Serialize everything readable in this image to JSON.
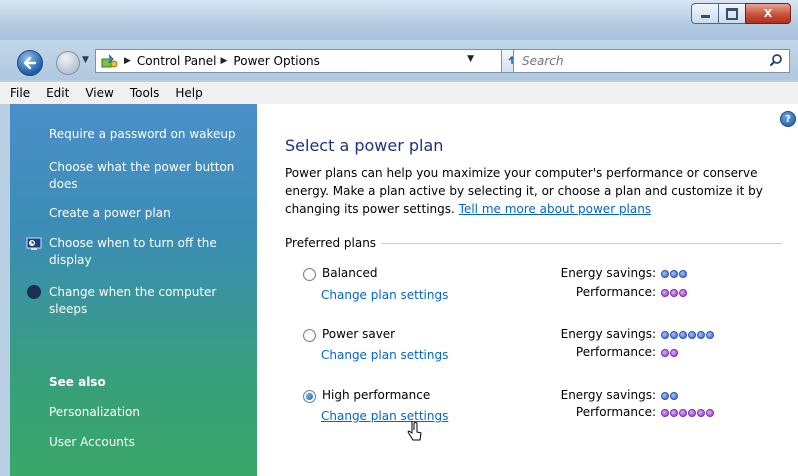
{
  "window": {
    "minimize": "",
    "maximize": "",
    "close": "X"
  },
  "nav": {
    "breadcrumbs": [
      "Control Panel",
      "Power Options"
    ],
    "search_placeholder": "Search"
  },
  "menu": [
    "File",
    "Edit",
    "View",
    "Tools",
    "Help"
  ],
  "sidebar": {
    "tasks": [
      {
        "label": "Require a password on wakeup",
        "icon": ""
      },
      {
        "label": "Choose what the power button does",
        "icon": ""
      },
      {
        "label": "Create a power plan",
        "icon": ""
      },
      {
        "label": "Choose when to turn off the display",
        "icon": "monitor-clock-icon"
      },
      {
        "label": "Change when the computer sleeps",
        "icon": "moon-icon"
      }
    ],
    "see_also_heading": "See also",
    "see_also": [
      "Personalization",
      "User Accounts"
    ]
  },
  "main": {
    "title": "Select a power plan",
    "description": "Power plans can help you maximize your computer's performance or conserve energy. Make a plan active by selecting it, or choose a plan and customize it by changing its power settings.",
    "description_link": "Tell me more about power plans",
    "section_label": "Preferred plans",
    "energy_label": "Energy savings:",
    "performance_label": "Performance:",
    "plans": [
      {
        "name": "Balanced",
        "link": "Change plan settings",
        "selected": false,
        "energy_savings": 3,
        "performance": 3
      },
      {
        "name": "Power saver",
        "link": "Change plan settings",
        "selected": false,
        "energy_savings": 6,
        "performance": 2
      },
      {
        "name": "High performance",
        "link": "Change plan settings",
        "selected": true,
        "energy_savings": 2,
        "performance": 6
      }
    ]
  },
  "colors": {
    "energy_dot": "#3a64d6",
    "performance_dot": "#9a3ad0",
    "title": "#1e3287",
    "link": "#0066cc"
  }
}
